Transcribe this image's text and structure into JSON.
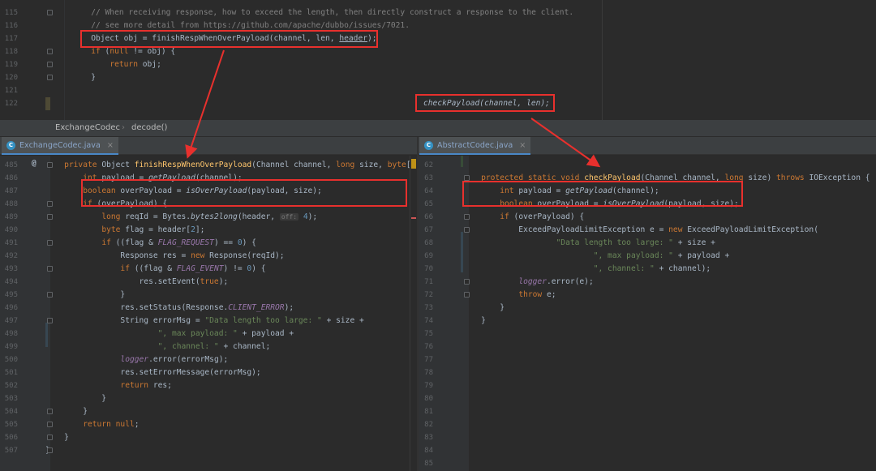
{
  "top_editor": {
    "line_numbers": [
      "115",
      "116",
      "117",
      "118",
      "119",
      "120",
      "121",
      "122"
    ],
    "lines": [
      [
        [
          "cm",
          "        // When receiving response, how to exceed the length, then directly construct a response to the client."
        ]
      ],
      [
        [
          "cm",
          "        // see more detail from https://github.com/apache/dubbo/issues/7021."
        ]
      ],
      [
        [
          "",
          "        Object obj = finishRespWhenOverPayload(channel, len, "
        ],
        [
          "u",
          "header"
        ],
        [
          "",
          ");"
        ]
      ],
      [
        [
          "",
          "        "
        ],
        [
          "kw",
          "if"
        ],
        [
          "",
          " ("
        ],
        [
          "kw",
          "null"
        ],
        [
          "",
          " != obj) {"
        ]
      ],
      [
        [
          "",
          "            "
        ],
        [
          "kw",
          "return"
        ],
        [
          "",
          " obj;"
        ]
      ],
      [
        [
          "",
          "        }"
        ]
      ],
      [
        [
          "",
          ""
        ]
      ],
      [
        [
          "",
          ""
        ]
      ]
    ],
    "snippet": "checkPayload(channel, len);"
  },
  "breadcrumb": {
    "class_name": "ExchangeCodec",
    "separator": "›",
    "method": "decode()"
  },
  "left_editor": {
    "tab": {
      "icon": "C",
      "label": "ExchangeCodec.java",
      "close": "×"
    },
    "line_numbers": [
      "485",
      "486",
      "487",
      "488",
      "489",
      "490",
      "491",
      "492",
      "493",
      "494",
      "495",
      "496",
      "497",
      "498",
      "499",
      "500",
      "501",
      "502",
      "503",
      "504",
      "505",
      "506",
      "507"
    ],
    "at_marker": "@",
    "lines": [
      [
        [
          "",
          "    "
        ],
        [
          "kw",
          "private"
        ],
        [
          "",
          " Object "
        ],
        [
          "fn",
          "finishRespWhenOverPayload"
        ],
        [
          "",
          "(Channel channel, "
        ],
        [
          "kw",
          "long"
        ],
        [
          "",
          " size, "
        ],
        [
          "kw",
          "byte"
        ],
        [
          "",
          "[]"
        ]
      ],
      [
        [
          "",
          "        "
        ],
        [
          "kw",
          "int"
        ],
        [
          "",
          " payload = "
        ],
        [
          "it",
          "getPayload"
        ],
        [
          "",
          "(channel);"
        ]
      ],
      [
        [
          "",
          "        "
        ],
        [
          "kw",
          "boolean"
        ],
        [
          "",
          " overPayload = "
        ],
        [
          "it",
          "isOverPayload"
        ],
        [
          "",
          "(payload, size);"
        ]
      ],
      [
        [
          "",
          "        "
        ],
        [
          "kw",
          "if"
        ],
        [
          "",
          " (overPayload) {"
        ]
      ],
      [
        [
          "",
          "            "
        ],
        [
          "kw",
          "long"
        ],
        [
          "",
          " reqId = Bytes."
        ],
        [
          "it",
          "bytes2long"
        ],
        [
          "",
          "(header, "
        ],
        [
          "hint",
          "off:"
        ],
        [
          "",
          " "
        ],
        [
          "num",
          "4"
        ],
        [
          "",
          ");"
        ]
      ],
      [
        [
          "",
          "            "
        ],
        [
          "kw",
          "byte"
        ],
        [
          "",
          " flag = header["
        ],
        [
          "num",
          "2"
        ],
        [
          "",
          "];"
        ]
      ],
      [
        [
          "",
          "            "
        ],
        [
          "kw",
          "if"
        ],
        [
          "",
          " ((flag & "
        ],
        [
          "cst",
          "FLAG_REQUEST"
        ],
        [
          "",
          ") == "
        ],
        [
          "num",
          "0"
        ],
        [
          "",
          ") {"
        ]
      ],
      [
        [
          "",
          "                Response res = "
        ],
        [
          "kw",
          "new"
        ],
        [
          "",
          " Response(reqId);"
        ]
      ],
      [
        [
          "",
          "                "
        ],
        [
          "kw",
          "if"
        ],
        [
          "",
          " ((flag & "
        ],
        [
          "cst",
          "FLAG_EVENT"
        ],
        [
          "",
          ") != "
        ],
        [
          "num",
          "0"
        ],
        [
          "",
          ") {"
        ]
      ],
      [
        [
          "",
          "                    res.setEvent("
        ],
        [
          "kw",
          "true"
        ],
        [
          "",
          ");"
        ]
      ],
      [
        [
          "",
          "                }"
        ]
      ],
      [
        [
          "",
          "                res.setStatus(Response."
        ],
        [
          "cst",
          "CLIENT_ERROR"
        ],
        [
          "",
          ");"
        ]
      ],
      [
        [
          "",
          "                String errorMsg = "
        ],
        [
          "str",
          "\"Data length too large: \""
        ],
        [
          "",
          " + size +"
        ]
      ],
      [
        [
          "",
          "                        "
        ],
        [
          "str",
          "\", max payload: \""
        ],
        [
          "",
          " + payload +"
        ]
      ],
      [
        [
          "",
          "                        "
        ],
        [
          "str",
          "\", channel: \""
        ],
        [
          "",
          " + channel;"
        ]
      ],
      [
        [
          "",
          "                "
        ],
        [
          "cst",
          "logger"
        ],
        [
          "",
          ".error(errorMsg);"
        ]
      ],
      [
        [
          "",
          "                res.setErrorMessage(errorMsg);"
        ]
      ],
      [
        [
          "",
          "                "
        ],
        [
          "kw",
          "return"
        ],
        [
          "",
          " res;"
        ]
      ],
      [
        [
          "",
          "            }"
        ]
      ],
      [
        [
          "",
          "        }"
        ]
      ],
      [
        [
          "",
          "        "
        ],
        [
          "kw",
          "return null"
        ],
        [
          "",
          ";"
        ]
      ],
      [
        [
          "",
          "    }"
        ]
      ],
      [
        [
          "",
          "}"
        ]
      ]
    ]
  },
  "right_editor": {
    "tab": {
      "icon": "C",
      "label": "AbstractCodec.java",
      "close": "×"
    },
    "line_numbers": [
      "62",
      "63",
      "64",
      "65",
      "66",
      "67",
      "68",
      "69",
      "70",
      "71",
      "72",
      "73",
      "74",
      "75",
      "76",
      "77",
      "78",
      "79",
      "80",
      "81",
      "82",
      "83",
      "84",
      "85"
    ],
    "lines": [
      [
        [
          "",
          ""
        ]
      ],
      [
        [
          "",
          "    "
        ],
        [
          "kw",
          "protected static void"
        ],
        [
          "",
          " "
        ],
        [
          "fn",
          "checkPayload"
        ],
        [
          "",
          "(Channel channel, "
        ],
        [
          "kw",
          "long"
        ],
        [
          "",
          " size) "
        ],
        [
          "kw",
          "throws"
        ],
        [
          "",
          " IOException {"
        ]
      ],
      [
        [
          "",
          "        "
        ],
        [
          "kw",
          "int"
        ],
        [
          "",
          " payload = "
        ],
        [
          "it",
          "getPayload"
        ],
        [
          "",
          "(channel);"
        ]
      ],
      [
        [
          "",
          "        "
        ],
        [
          "kw",
          "boolean"
        ],
        [
          "",
          " overPayload = "
        ],
        [
          "it",
          "isOverPayload"
        ],
        [
          "",
          "(payload, size);"
        ]
      ],
      [
        [
          "",
          "        "
        ],
        [
          "kw",
          "if"
        ],
        [
          "",
          " (overPayload) {"
        ]
      ],
      [
        [
          "",
          "            ExceedPayloadLimitException e = "
        ],
        [
          "kw",
          "new"
        ],
        [
          "",
          " ExceedPayloadLimitException("
        ]
      ],
      [
        [
          "",
          "                    "
        ],
        [
          "str",
          "\"Data length too large: \""
        ],
        [
          "",
          " + size +"
        ]
      ],
      [
        [
          "",
          "                            "
        ],
        [
          "str",
          "\", max payload: \""
        ],
        [
          "",
          " + payload +"
        ]
      ],
      [
        [
          "",
          "                            "
        ],
        [
          "str",
          "\", channel: \""
        ],
        [
          "",
          " + channel);"
        ]
      ],
      [
        [
          "",
          "            "
        ],
        [
          "cst",
          "logger"
        ],
        [
          "",
          ".error(e);"
        ]
      ],
      [
        [
          "",
          "            "
        ],
        [
          "kw",
          "throw"
        ],
        [
          "",
          " e;"
        ]
      ],
      [
        [
          "",
          "        }"
        ]
      ],
      [
        [
          "",
          "    }"
        ]
      ],
      [
        [
          "",
          ""
        ]
      ],
      [
        [
          "",
          ""
        ]
      ],
      [
        [
          "",
          ""
        ]
      ],
      [
        [
          "",
          ""
        ]
      ],
      [
        [
          "",
          ""
        ]
      ],
      [
        [
          "",
          ""
        ]
      ],
      [
        [
          "",
          ""
        ]
      ],
      [
        [
          "",
          ""
        ]
      ],
      [
        [
          "",
          ""
        ]
      ],
      [
        [
          "",
          ""
        ]
      ],
      [
        [
          "",
          ""
        ]
      ]
    ]
  },
  "colors": {
    "annotation_red": "#e8302d",
    "keyword": "#cc7832",
    "method_decl": "#ffc66d",
    "string": "#6a8759",
    "number": "#6897bb",
    "constant": "#9876aa"
  }
}
